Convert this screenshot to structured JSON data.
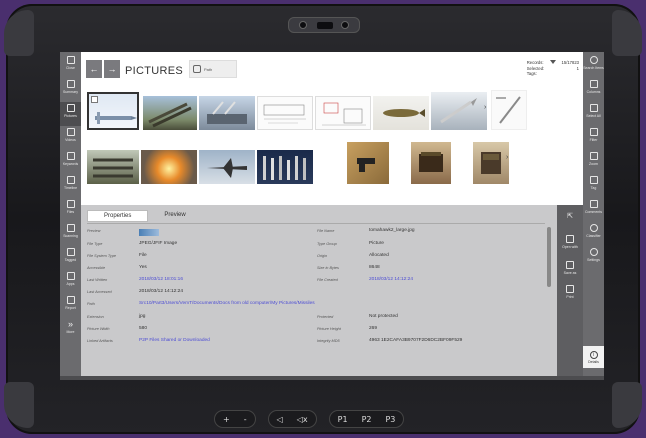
{
  "hardware": {
    "buttons": [
      "+",
      "-",
      "◁",
      "◁x",
      "P1",
      "P2",
      "P3"
    ]
  },
  "left_rail": [
    {
      "label": "Close",
      "icon": "chevron-left-icon"
    },
    {
      "label": "Summary",
      "icon": "document-icon"
    },
    {
      "label": "Pictures",
      "icon": "picture-icon",
      "active": true
    },
    {
      "label": "Videos",
      "icon": "video-icon"
    },
    {
      "label": "Keywords",
      "icon": "keyword-icon"
    },
    {
      "label": "Timeline",
      "icon": "timeline-icon"
    },
    {
      "label": "Files",
      "icon": "file-icon"
    },
    {
      "label": "Scanning",
      "icon": "scan-icon"
    },
    {
      "label": "Tagged",
      "icon": "tag-icon"
    },
    {
      "label": "Apps",
      "icon": "apps-icon"
    },
    {
      "label": "Report",
      "icon": "report-icon"
    },
    {
      "label": "More",
      "icon": "chevron-right-icon"
    }
  ],
  "right_rail": [
    {
      "label": "Search Items",
      "icon": "search-icon"
    },
    {
      "label": "Columns",
      "icon": "columns-icon"
    },
    {
      "label": "Select All",
      "icon": "select-all-icon"
    },
    {
      "label": "Filter",
      "icon": "filter-icon"
    },
    {
      "label": "Zoom",
      "icon": "zoom-icon"
    },
    {
      "label": "Tag",
      "icon": "tag-icon"
    },
    {
      "label": "Comments",
      "icon": "comment-icon"
    },
    {
      "label": "Classifier",
      "icon": "eye-icon"
    },
    {
      "label": "Settings",
      "icon": "gear-icon"
    }
  ],
  "header": {
    "title": "PICTURES",
    "path_chip": "Path",
    "records_label": "Records:",
    "records_value": "15/17823",
    "selected_label": "Selected:",
    "selected_value": "1",
    "tags_label": "Tags:"
  },
  "tabs": [
    "Properties",
    "Preview"
  ],
  "properties": [
    {
      "k": "Preview",
      "v": "",
      "k2": "File Name",
      "v2": "tomahawk2_large.jpg"
    },
    {
      "k": "File Type",
      "v": "JPEG/JFIF Image",
      "k2": "Type Group",
      "v2": "Picture"
    },
    {
      "k": "File System Type",
      "v": "File",
      "k2": "Origin",
      "v2": "Allocated"
    },
    {
      "k": "Accessible",
      "v": "Yes",
      "k2": "Size in Bytes",
      "v2": "8648"
    },
    {
      "k": "Last Written",
      "v": "2018/03/12 18:01:16",
      "k2": "File Created",
      "v2": "2018/03/12 14:12:24",
      "link": true
    },
    {
      "k": "Last Accessed",
      "v": "2018/03/12 14:12:24",
      "k2": "",
      "v2": ""
    },
    {
      "k": "Path",
      "v": "Src10/Part3/Users/VemT/Documents/Docs from old computer/My Pictures/Missiles",
      "k2": "",
      "v2": "",
      "link_v": true
    },
    {
      "k": "Extension",
      "v": "jpg",
      "k2": "Protected",
      "v2": "Not protected"
    },
    {
      "k": "Picture Width",
      "v": "580",
      "k2": "Picture Height",
      "v2": "269"
    },
    {
      "k": "Linked Artifacts",
      "v": "P2P Files Shared or Downloaded",
      "k2": "Integrity MD5",
      "v2": "4963 1E2CAFA3B9707F2D6DC2BF09F529",
      "link_v": true
    }
  ],
  "action_col": [
    {
      "label": "Open with",
      "icon": "open-icon"
    },
    {
      "label": "Save as",
      "icon": "save-icon"
    },
    {
      "label": "Print",
      "icon": "print-icon"
    }
  ],
  "details_label": "Details",
  "colors": {
    "screen_bg": "#6f6f72",
    "link": "#4d4dd4",
    "panel_bg": "#c9c9cb"
  }
}
